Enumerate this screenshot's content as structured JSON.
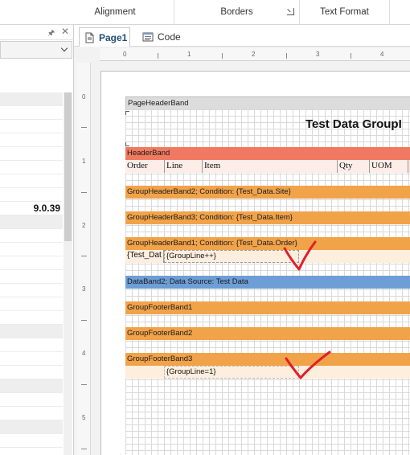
{
  "ribbon": {
    "groups": [
      "Alignment",
      "Borders",
      "Text Format"
    ]
  },
  "left_panel": {
    "pin_icon": "pin-icon",
    "close_icon": "close-icon",
    "highlight_value": "9.0.39"
  },
  "tabs": [
    {
      "label": "Page1",
      "icon": "page-icon",
      "active": true
    },
    {
      "label": "Code",
      "icon": "code-icon",
      "active": false
    }
  ],
  "rulers": {
    "horizontal": [
      "0",
      "1",
      "2",
      "3",
      "4"
    ],
    "vertical": [
      "0",
      "1",
      "2",
      "3",
      "4",
      "5"
    ]
  },
  "report": {
    "title": "Test Data GroupI",
    "bands": {
      "page_header": "PageHeaderBand",
      "header": "HeaderBand",
      "group2": "GroupHeaderBand2; Condition: {Test_Data.Site}",
      "group3": "GroupHeaderBand3; Condition: {Test_Data.Item}",
      "group1": "GroupHeaderBand1; Condition: {Test_Data.Order}",
      "data": "DataBand2; Data Source: Test Data",
      "footer1": "GroupFooterBand1",
      "footer2": "GroupFooterBand2",
      "footer3": "GroupFooterBand3"
    },
    "header_columns": [
      "Order",
      "Line",
      "Item",
      "Qty",
      "UOM"
    ],
    "group1_fields": [
      "{Test_Dat",
      "{GroupLine++}"
    ],
    "footer3_fields": [
      "{GroupLine=1}"
    ]
  },
  "annotation_color": "#e0202a"
}
